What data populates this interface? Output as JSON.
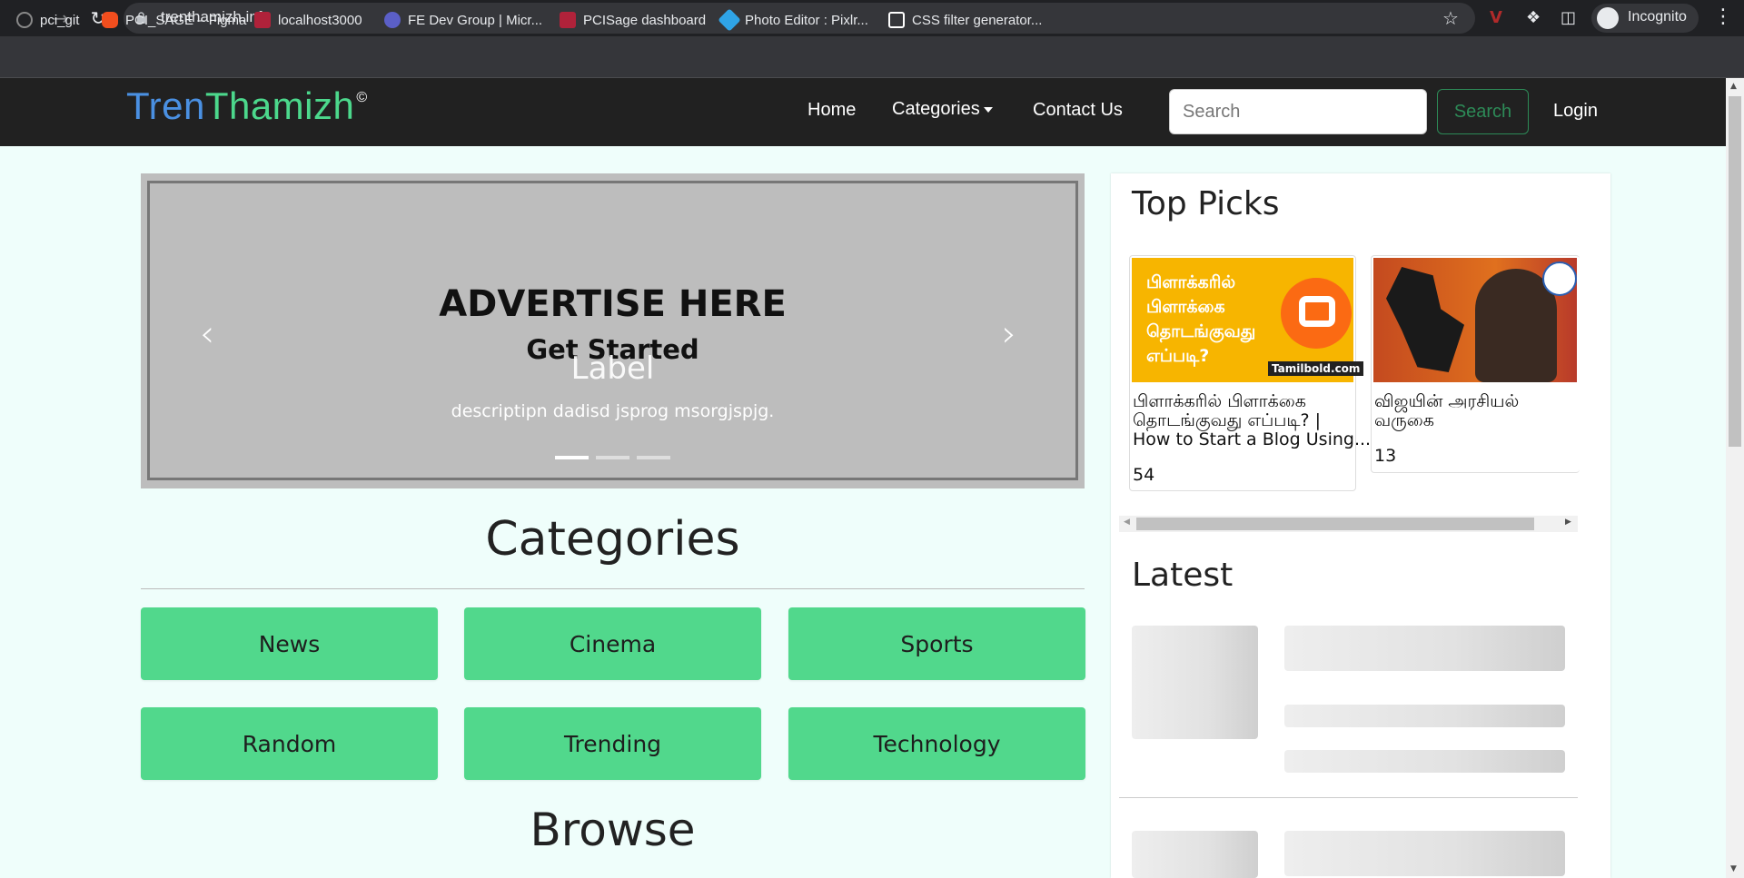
{
  "browser": {
    "url": "trenthamizh.info",
    "profile_label": "Incognito",
    "bookmarks": [
      {
        "label": "pci_git",
        "icon": "github-icon",
        "color": "#202124"
      },
      {
        "label": "PCI_SAGE – Figma",
        "icon": "figma-icon",
        "color": "#f24e1e"
      },
      {
        "label": "localhost3000",
        "icon": "r-app-icon",
        "color": "#b0223a"
      },
      {
        "label": "FE Dev Group | Micr...",
        "icon": "teams-icon",
        "color": "#5b5fc7"
      },
      {
        "label": "PCISage dashboard",
        "icon": "r-app-icon",
        "color": "#b0223a"
      },
      {
        "label": "Photo Editor : Pixlr...",
        "icon": "pixlr-icon",
        "color": "#2fa4e7"
      },
      {
        "label": "CSS filter generator...",
        "icon": "codepen-icon",
        "color": "#ffffff"
      }
    ]
  },
  "site": {
    "brand_part1": "Tren",
    "brand_part2": "Thamizh",
    "brand_mark": "©",
    "colors": {
      "brand_blue": "#4a90e2",
      "brand_green": "#4cd88c",
      "navbar_bg": "#212121",
      "category_green": "#51d88c"
    },
    "nav": {
      "home": "Home",
      "categories": "Categories",
      "contact": "Contact Us",
      "search_placeholder": "Search",
      "search_button": "Search",
      "login": "Login"
    }
  },
  "carousel": {
    "ad_title": "ADVERTISE HERE",
    "ad_subtitle": "Get Started",
    "caption_label": "Label",
    "caption_description": "descriptipn dadisd jsprog msorgjspjg.",
    "slide_count": 3,
    "active_slide": 1
  },
  "categories": {
    "heading": "Categories",
    "items": [
      "News",
      "Cinema",
      "Sports",
      "Random",
      "Trending",
      "Technology"
    ]
  },
  "browse": {
    "heading": "Browse"
  },
  "top_picks": {
    "heading": "Top Picks",
    "items": [
      {
        "thumb_text_lines": [
          "பிளாக்கரில்",
          "பிளாக்கை",
          "தொடங்குவது",
          "எப்படி?"
        ],
        "thumb_watermark": "Tamilbold.com",
        "title_line1": "பிளாக்கரில் பிளாக்கை",
        "title_line2": "தொடங்குவது எப்படி? |",
        "title_line3": "How to Start a Blog Using...",
        "count": "54"
      },
      {
        "title_line1": "விஜயின் அரசியல்",
        "title_line2": "வருகை",
        "count": "13"
      }
    ]
  },
  "latest": {
    "heading": "Latest"
  }
}
